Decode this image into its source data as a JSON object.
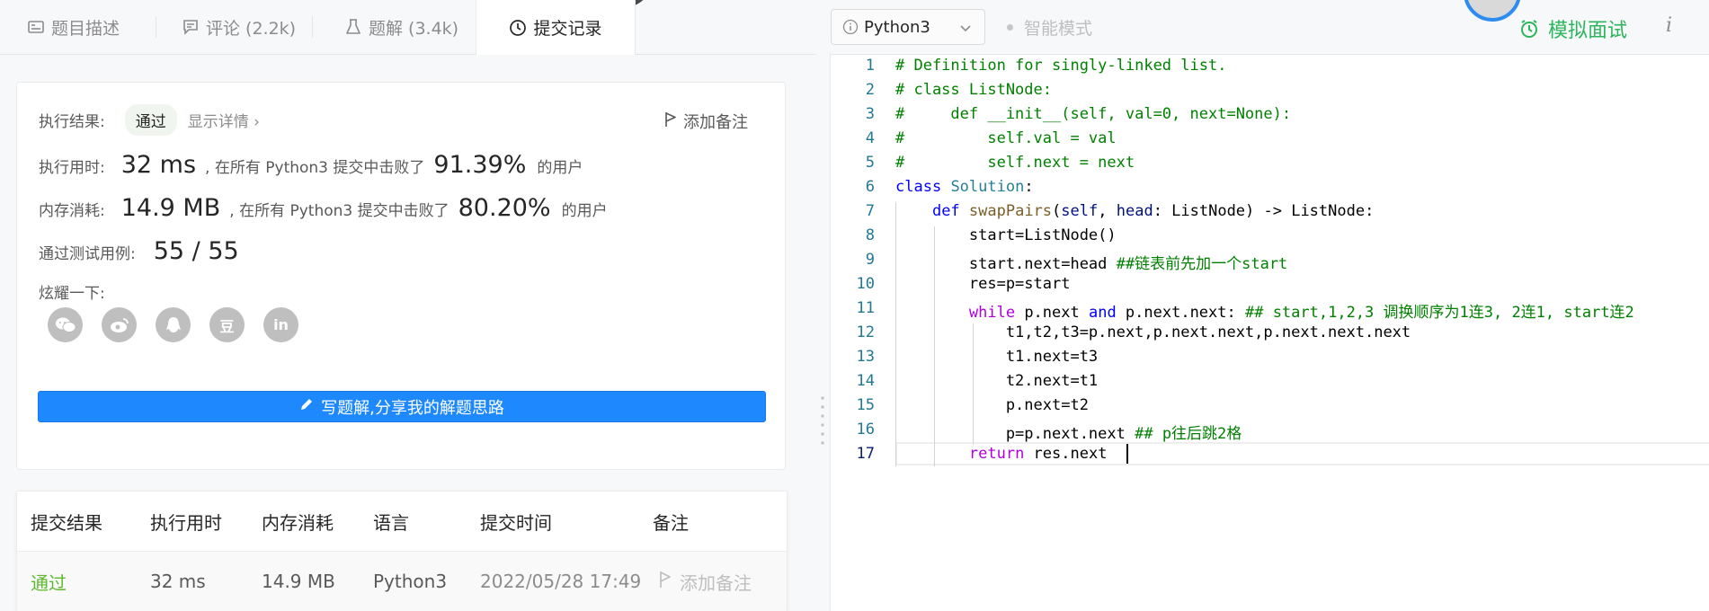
{
  "tabs": [
    {
      "label": "题目描述",
      "icon": "description-icon"
    },
    {
      "label": "评论 (2.2k)",
      "icon": "comment-icon"
    },
    {
      "label": "题解 (3.4k)",
      "icon": "flask-icon"
    },
    {
      "label": "提交记录",
      "icon": "clock-icon",
      "active": true
    }
  ],
  "result": {
    "status_label": "执行结果:",
    "status_value": "通过",
    "details_link": "显示详情 ›",
    "add_note": "添加备注",
    "runtime_label": "执行用时:",
    "runtime_value": "32 ms",
    "runtime_mid": ", 在所有 Python3 提交中击败了",
    "runtime_percent": "91.39%",
    "runtime_suffix": "的用户",
    "memory_label": "内存消耗:",
    "memory_value": "14.9 MB",
    "memory_mid": ", 在所有 Python3 提交中击败了",
    "memory_percent": "80.20%",
    "memory_suffix": "的用户",
    "tests_label": "通过测试用例:",
    "tests_value": "55 / 55",
    "share_label": "炫耀一下:",
    "share_icons": [
      "wechat-icon",
      "weibo-icon",
      "qq-icon",
      "douban-icon",
      "linkedin-icon"
    ],
    "share_glyphs": [
      "",
      "",
      "",
      "豆",
      "in"
    ],
    "write_button": "写题解,分享我的解题思路"
  },
  "submissions": {
    "headers": [
      "提交结果",
      "执行用时",
      "内存消耗",
      "语言",
      "提交时间",
      "备注"
    ],
    "rows": [
      {
        "status": "通过",
        "runtime": "32 ms",
        "memory": "14.9 MB",
        "language": "Python3",
        "time": "2022/05/28 17:49",
        "note": "添加备注"
      }
    ]
  },
  "editor_toolbar": {
    "language": "Python3",
    "smart_mode": "智能模式",
    "mock_interview": "模拟面试",
    "info": "i"
  },
  "code": {
    "lines": [
      "# Definition for singly-linked list.",
      "# class ListNode:",
      "#     def __init__(self, val=0, next=None):",
      "#         self.val = val",
      "#         self.next = next",
      "class Solution:",
      "    def swapPairs(self, head: ListNode) -> ListNode:",
      "        start=ListNode()",
      "        start.next=head ##链表前先加一个start",
      "        res=p=start",
      "        while p.next and p.next.next: ## start,1,2,3 调换顺序为1连3, 2连1, start连2",
      "            t1,t2,t3=p.next,p.next.next,p.next.next.next",
      "            t1.next=t3",
      "            t2.next=t1",
      "            p.next=t2",
      "            p=p.next.next ## p往后跳2格",
      "        return res.next "
    ],
    "current_line": 17
  },
  "colors": {
    "accent_blue": "#1e88ff",
    "success_green": "#2db55d",
    "pass_green": "#5cb82e"
  }
}
